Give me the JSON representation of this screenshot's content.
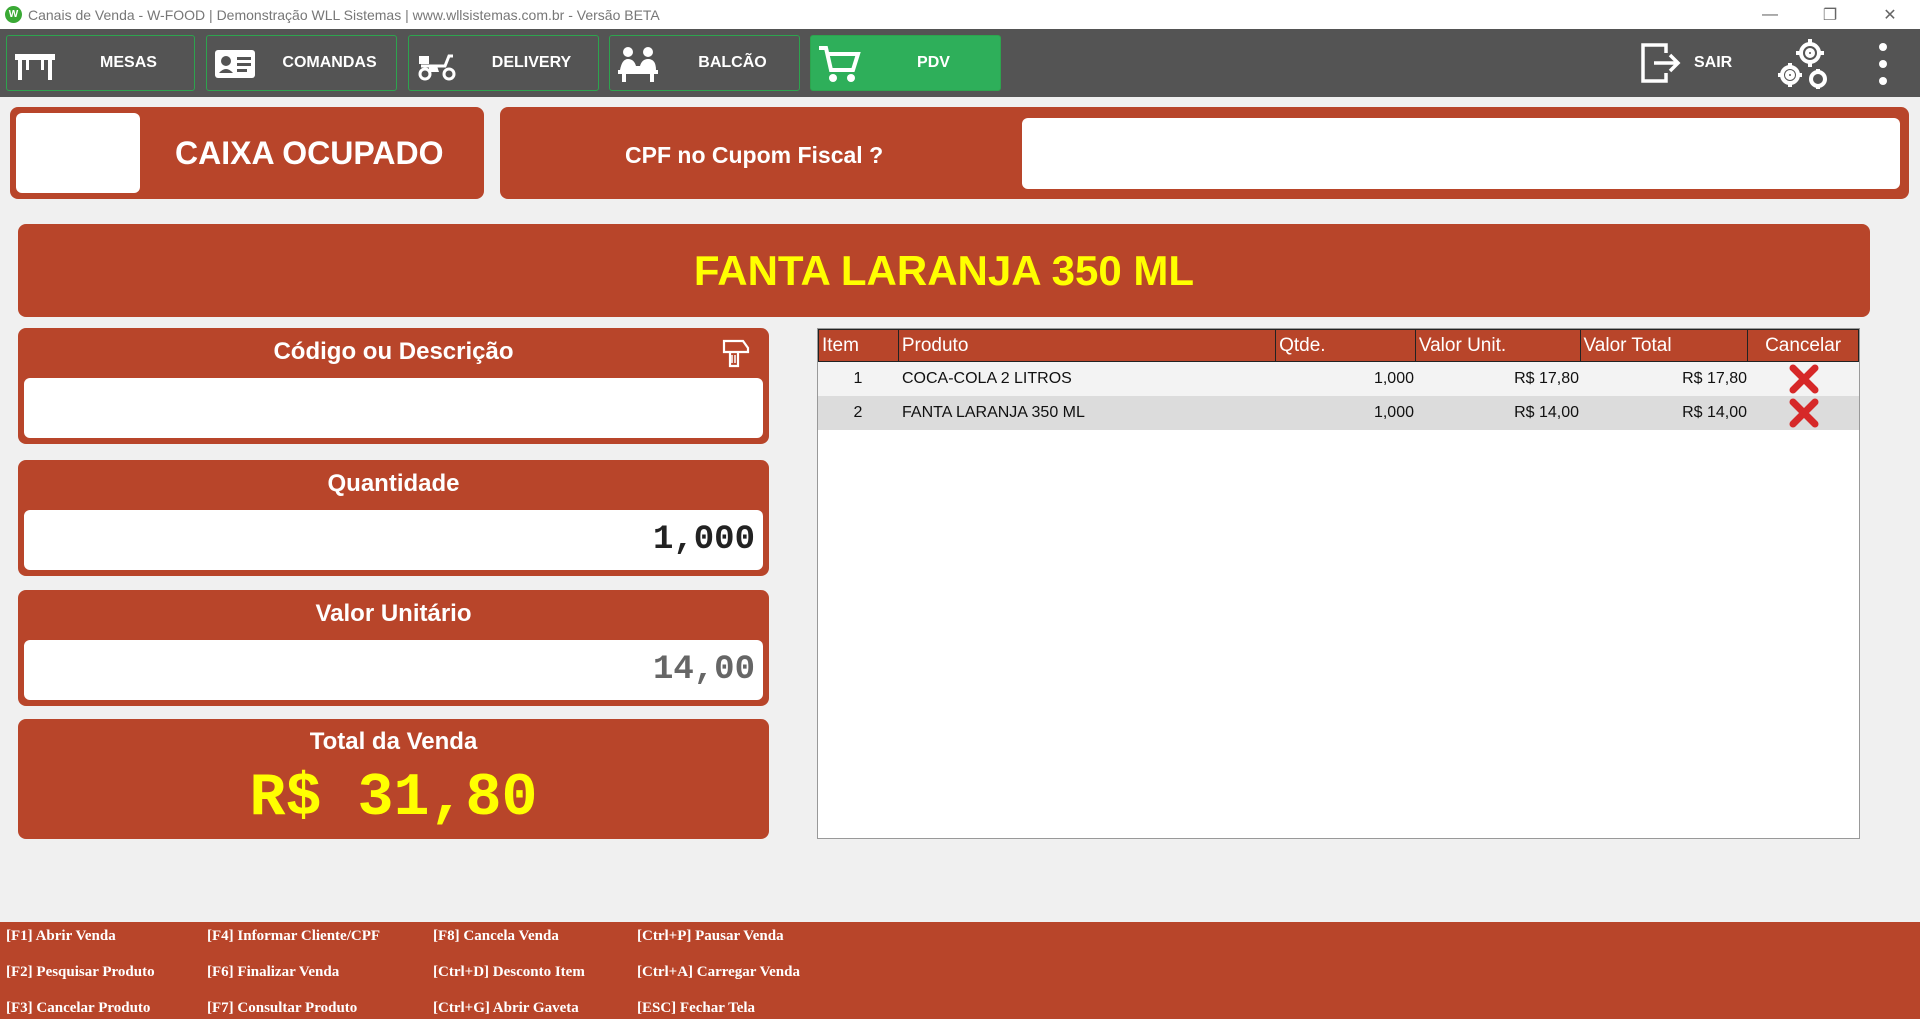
{
  "window": {
    "title": "Canais de Venda - W-FOOD | Demonstração WLL Sistemas | www.wllsistemas.com.br - Versão BETA",
    "controls": [
      "—",
      "❐",
      "✕"
    ]
  },
  "toolbar": {
    "mesas": "MESAS",
    "comandas": "COMANDAS",
    "delivery": "DELIVERY",
    "balcao": "BALCÃO",
    "pdv": "PDV",
    "sair": "SAIR",
    "active_color": "#2eaf5a"
  },
  "status": {
    "caixa": "CAIXA OCUPADO",
    "cpf_label": "CPF no Cupom Fiscal ?",
    "cpf_value": ""
  },
  "current_product": "FANTA LARANJA 350 ML",
  "form": {
    "codigo_label": "Código ou Descrição",
    "codigo_value": "",
    "quantidade_label": "Quantidade",
    "quantidade_value": "1,000",
    "valor_unit_label": "Valor Unitário",
    "valor_unit_value": "14,00",
    "total_label": "Total da Venda",
    "total_value": "R$ 31,80"
  },
  "table": {
    "headers": [
      "Item",
      "Produto",
      "Qtde.",
      "Valor Unit.",
      "Valor Total",
      "Cancelar"
    ],
    "rows": [
      {
        "item": "1",
        "produto": "COCA-COLA 2 LITROS",
        "qtde": "1,000",
        "valor_unit": "R$ 17,80",
        "valor_total": "R$ 17,80"
      },
      {
        "item": "2",
        "produto": "FANTA LARANJA 350 ML",
        "qtde": "1,000",
        "valor_unit": "R$ 14,00",
        "valor_total": "R$ 14,00"
      }
    ]
  },
  "footer": {
    "f1": "[F1] Abrir Venda",
    "f2": "[F2] Pesquisar Produto",
    "f3": "[F3] Cancelar Produto",
    "f4": "[F4] Informar Cliente/CPF",
    "f6": "[F6] Finalizar Venda",
    "f7": "[F7] Consultar Produto",
    "f8": "[F8] Cancela Venda",
    "ctrl_d": "[Ctrl+D] Desconto Item",
    "ctrl_g": "[Ctrl+G] Abrir Gaveta",
    "ctrl_p": "[Ctrl+P] Pausar Venda",
    "ctrl_a": "[Ctrl+A] Carregar Venda",
    "esc": "[ESC] Fechar Tela"
  },
  "colors": {
    "brand_red": "#b8452a",
    "highlight_yellow": "#ffff00",
    "toolbar_gray": "#545454"
  }
}
